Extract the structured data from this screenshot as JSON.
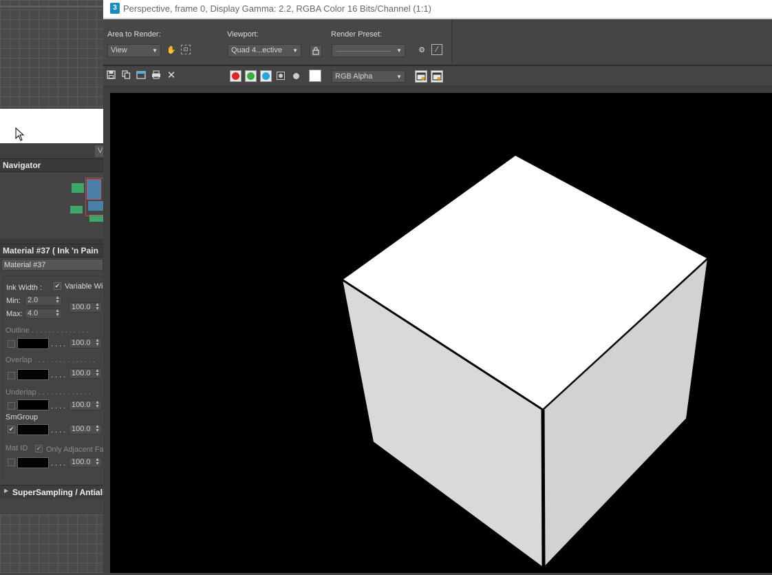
{
  "render_window": {
    "title": "Perspective, frame 0, Display Gamma: 2.2, RGBA Color 16 Bits/Channel (1:1)",
    "app_badge": "3",
    "area_to_render_label": "Area to Render:",
    "area_to_render_value": "View",
    "viewport_label": "Viewport:",
    "viewport_value": "Quad 4...ective",
    "render_preset_label": "Render Preset:",
    "render_preset_value": "",
    "channel_value": "RGB Alpha",
    "channel_colors": {
      "red": "#e0262a",
      "green": "#33b040",
      "blue": "#22a6dc"
    }
  },
  "left_panel": {
    "tab_stub": "V",
    "navigator_title": "Navigator",
    "material_title": "Material #37  ( Ink 'n Pain",
    "material_name": "Material #37",
    "ink_width_label": "Ink Width :",
    "variable_width_label": "Variable Wid",
    "min_label": "Min:",
    "min_value": "2.0",
    "max_label": "Max:",
    "max_value": "4.0",
    "variable_value": "100.0",
    "outline_label": "Outline . . . . . . . . . . . . . .",
    "outline_value": "100.0",
    "overlap_label": "Overlap . . . . . . . . . . . . . . .",
    "overlap_value": "100.0",
    "underlap_label": "Underlap . . . . . . . . . . . . .",
    "underlap_value": "100.0",
    "smgroup_label": "SmGroup",
    "smgroup_value": "100.0",
    "matid_label": "Mat ID",
    "only_adjacent_label": "Only Adjacent Fa",
    "matid_value": "100.0",
    "dots": ". . . .",
    "supersampling_label": "SuperSampling / Antiali"
  }
}
